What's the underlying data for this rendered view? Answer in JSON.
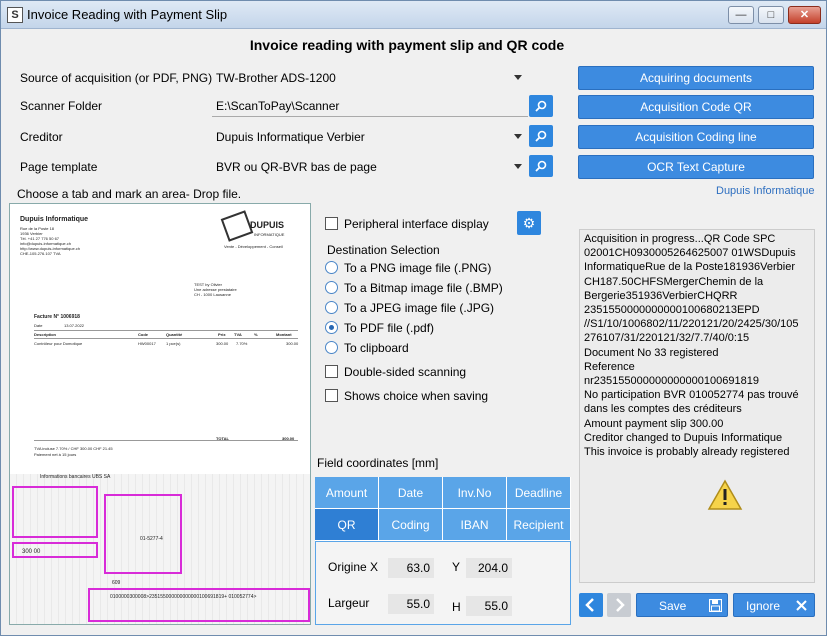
{
  "window": {
    "title": "Invoice Reading with Payment Slip"
  },
  "heading": "Invoice reading with payment slip and QR code",
  "form": {
    "source_label": "Source of acquisition (or PDF, PNG)",
    "source_value": "TW-Brother ADS-1200",
    "folder_label": "Scanner Folder",
    "folder_value": "E:\\ScanToPay\\Scanner",
    "creditor_label": "Creditor",
    "creditor_value": "Dupuis Informatique  Verbier",
    "template_label": "Page template",
    "template_value": "BVR ou QR-BVR bas de page"
  },
  "actions": {
    "acquiring": "Acquiring documents",
    "qr": "Acquisition Code QR",
    "coding": "Acquisition Coding line",
    "ocr": "OCR Text Capture",
    "link": "Dupuis Informatique"
  },
  "hint": "Choose a tab and mark an area- Drop file.",
  "options": {
    "peripheral": "Peripheral interface display",
    "destination_title": "Destination Selection",
    "destinations": [
      "To a PNG image file (.PNG)",
      "To a Bitmap image file (.BMP)",
      "To a JPEG image file (.JPG)",
      "To PDF file (.pdf)",
      "To clipboard"
    ],
    "selected_destination": "To PDF file (.pdf)",
    "double_sided": "Double-sided scanning",
    "shows_choice": "Shows choice when saving"
  },
  "fields": {
    "title": "Field coordinates [mm]",
    "tabs_row1": [
      "Amount",
      "Date",
      "Inv.No",
      "Deadline"
    ],
    "tabs_row2": [
      "QR",
      "Coding",
      "IBAN",
      "Recipient"
    ],
    "active_tab": "QR",
    "origin_label": "Origine X",
    "origin_x": "63.0",
    "y_label": "Y",
    "y_value": "204.0",
    "width_label": "Largeur",
    "width_value": "55.0",
    "h_label": "H",
    "h_value": "55.0"
  },
  "log": [
    "Acquisition in progress...QR Code SPC 02001CH0930005264625007 01WSDupuis InformatiqueRue de la Poste181936Verbier CH187.50CHFSMergerChemin de la Bergerie351936VerbierCHQRR 2351550000000000100680213EPD //S1/10/1006802/11/220121/20/2425/30/105 276107/31/220121/32/7.7/40/0:15",
    "Document No 33 registered",
    "",
    "Reference nr235155000000000000100691819",
    "No participation BVR 010052774 pas trouvé dans les comptes des créditeurs",
    "Amount payment slip 300.00",
    "Creditor changed to Dupuis Informatique",
    "This invoice is probably already registered"
  ],
  "buttons": {
    "save": "Save",
    "ignore": "Ignore"
  },
  "document": {
    "company": "Dupuis Informatique",
    "addr1": "Rue de la Poste 18",
    "addr2": "1936 Verbier",
    "tel": "Tél. +41 27 776 50 67",
    "mail": "info@dupuis-informatique.ch",
    "web": "http://www.dupuis-informatique.ch",
    "che": "CHE-105.276.107 TVA",
    "logo": "DUPUIS",
    "logo_sub": "INFORMATIQUE",
    "tagline": "Vente - Développement - Conseil",
    "recipient1": "TEST by Olivier",
    "recipient2": "Une adresse prestataire",
    "recipient3": "CH - 1000 Lausanne",
    "facture": "Facture N° 1006918",
    "date_label": "Date",
    "date_value": "13.07.2022",
    "col_desc": "Description",
    "col_code": "Code",
    "col_qty": "Quantité",
    "col_prix": "Prix",
    "col_tva": "TVA",
    "col_pct": "%",
    "col_montant": "Montant",
    "line_desc": "Contrôleur pour Domotique",
    "line_code": "HW00017",
    "line_qty": "1 pce(s)",
    "line_prix": "300.00",
    "line_tva": "7.70%",
    "line_montant": "300.00",
    "total_label": "TOTAL",
    "total_value": "300.00",
    "tva_note": "TVA incluse 7.70% / CHF 300.00 CHF 21.45",
    "payment_note": "Paiement net à 15 jours",
    "slip_header": "Informations bancaires UBS SA",
    "slip_amount": "300  00",
    "coding_line": "0100000300008>235155000000000000100691819+ 010052774>",
    "slip_account": "01-5277-4",
    "slip_number": "609"
  }
}
